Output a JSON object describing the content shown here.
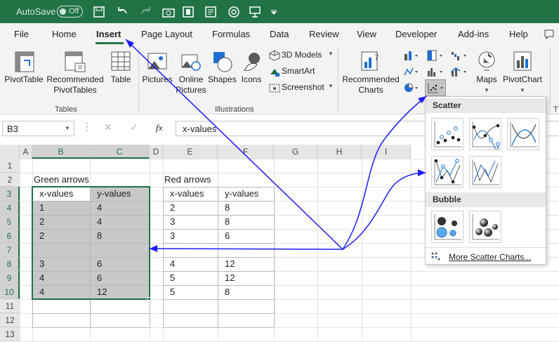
{
  "titlebar": {
    "autosave": "AutoSave",
    "autosave_state": "Off"
  },
  "tabs": [
    "File",
    "Home",
    "Insert",
    "Page Layout",
    "Formulas",
    "Data",
    "Review",
    "View",
    "Developer",
    "Add-ins",
    "Help"
  ],
  "ribbon": {
    "pivottable": "PivotTable",
    "rec_pivot_1": "Recommended",
    "rec_pivot_2": "PivotTables",
    "table": "Table",
    "pictures": "Pictures",
    "online_1": "Online",
    "online_2": "Pictures",
    "shapes": "Shapes",
    "icons": "Icons",
    "models": "3D Models",
    "smartart": "SmartArt",
    "screenshot": "Screenshot",
    "rec_charts_1": "Recommended",
    "rec_charts_2": "Charts",
    "maps": "Maps",
    "pivotchart": "PivotChart",
    "group_tables": "Tables",
    "group_illustrations": "Illustrations",
    "group_cut": "T"
  },
  "formula": {
    "namebox": "B3",
    "fx": "fx",
    "content": "x-values"
  },
  "columns": [
    "A",
    "B",
    "C",
    "D",
    "E",
    "F",
    "G",
    "H",
    "I"
  ],
  "rows": [
    "1",
    "2",
    "3",
    "4",
    "5",
    "6",
    "7",
    "8",
    "9",
    "10",
    "11",
    "12",
    "13"
  ],
  "sheet": {
    "green_title": "Green arrows",
    "red_title": "Red arrows",
    "hx": "x-values",
    "hy": "y-values",
    "green_rows": [
      [
        "1",
        "4"
      ],
      [
        "2",
        "4"
      ],
      [
        "2",
        "8"
      ],
      [
        "",
        ""
      ],
      [
        "3",
        "6"
      ],
      [
        "4",
        "6"
      ],
      [
        "4",
        "12"
      ]
    ],
    "red_rows": [
      [
        "2",
        "8"
      ],
      [
        "3",
        "8"
      ],
      [
        "3",
        "6"
      ],
      [
        "",
        ""
      ],
      [
        "4",
        "12"
      ],
      [
        "5",
        "12"
      ],
      [
        "5",
        "8"
      ]
    ]
  },
  "dropdown": {
    "scatter": "Scatter",
    "bubble": "Bubble",
    "more": "More Scatter Charts..."
  },
  "colors": {
    "excel_green": "#217346",
    "arrow": "#1a1aff",
    "selection": "#c8c8c8"
  }
}
